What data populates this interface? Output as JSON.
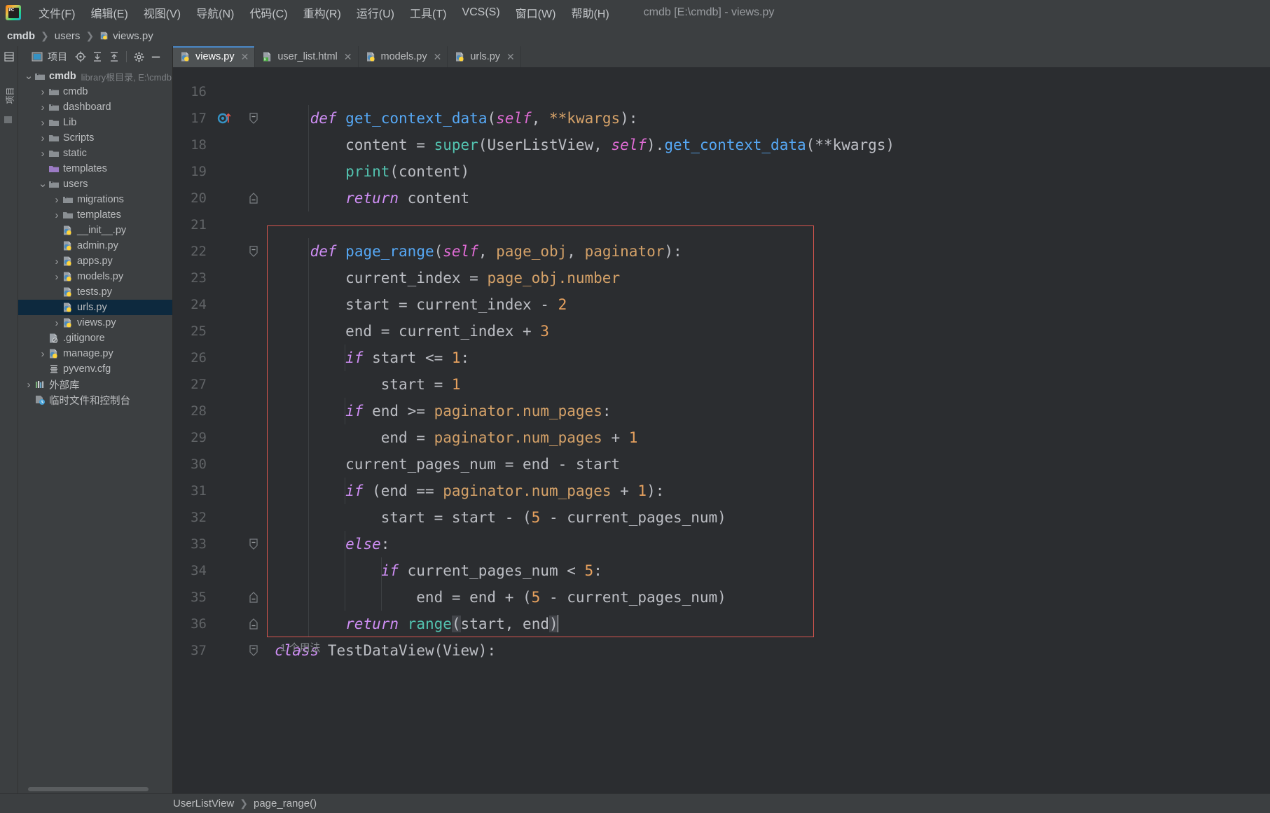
{
  "window": {
    "title": "cmdb [E:\\cmdb] - views.py"
  },
  "menu": {
    "items": [
      {
        "label": "文件(F)",
        "name": "menu-file"
      },
      {
        "label": "编辑(E)",
        "name": "menu-edit"
      },
      {
        "label": "视图(V)",
        "name": "menu-view"
      },
      {
        "label": "导航(N)",
        "name": "menu-navigate"
      },
      {
        "label": "代码(C)",
        "name": "menu-code"
      },
      {
        "label": "重构(R)",
        "name": "menu-refactor"
      },
      {
        "label": "运行(U)",
        "name": "menu-run"
      },
      {
        "label": "工具(T)",
        "name": "menu-tools"
      },
      {
        "label": "VCS(S)",
        "name": "menu-vcs"
      },
      {
        "label": "窗口(W)",
        "name": "menu-window"
      },
      {
        "label": "帮助(H)",
        "name": "menu-help"
      }
    ]
  },
  "breadcrumb": {
    "items": [
      "cmdb",
      "users",
      "views.py"
    ]
  },
  "toolstrip": {
    "vertical_label": "项目"
  },
  "project_panel": {
    "toolbar_label": "项目",
    "tree": [
      {
        "label": "cmdb",
        "sub": "library根目录, E:\\cmdb",
        "depth": 0,
        "chev": "v",
        "icon": "folder-module",
        "bold": true,
        "selected": false
      },
      {
        "label": "cmdb",
        "sub": "",
        "depth": 1,
        "chev": ">",
        "icon": "folder-module",
        "bold": false,
        "selected": false
      },
      {
        "label": "dashboard",
        "sub": "",
        "depth": 1,
        "chev": ">",
        "icon": "folder-module",
        "bold": false,
        "selected": false
      },
      {
        "label": "Lib",
        "sub": "",
        "depth": 1,
        "chev": ">",
        "icon": "folder",
        "bold": false,
        "selected": false
      },
      {
        "label": "Scripts",
        "sub": "",
        "depth": 1,
        "chev": ">",
        "icon": "folder",
        "bold": false,
        "selected": false
      },
      {
        "label": "static",
        "sub": "",
        "depth": 1,
        "chev": ">",
        "icon": "folder",
        "bold": false,
        "selected": false
      },
      {
        "label": "templates",
        "sub": "",
        "depth": 1,
        "chev": "",
        "icon": "folder-templates",
        "bold": false,
        "selected": false
      },
      {
        "label": "users",
        "sub": "",
        "depth": 1,
        "chev": "v",
        "icon": "folder-module",
        "bold": false,
        "selected": false
      },
      {
        "label": "migrations",
        "sub": "",
        "depth": 2,
        "chev": ">",
        "icon": "folder-module",
        "bold": false,
        "selected": false
      },
      {
        "label": "templates",
        "sub": "",
        "depth": 2,
        "chev": ">",
        "icon": "folder",
        "bold": false,
        "selected": false
      },
      {
        "label": "__init__.py",
        "sub": "",
        "depth": 2,
        "chev": "",
        "icon": "python",
        "bold": false,
        "selected": false
      },
      {
        "label": "admin.py",
        "sub": "",
        "depth": 2,
        "chev": "",
        "icon": "python",
        "bold": false,
        "selected": false
      },
      {
        "label": "apps.py",
        "sub": "",
        "depth": 2,
        "chev": ">",
        "icon": "python",
        "bold": false,
        "selected": false
      },
      {
        "label": "models.py",
        "sub": "",
        "depth": 2,
        "chev": ">",
        "icon": "python",
        "bold": false,
        "selected": false
      },
      {
        "label": "tests.py",
        "sub": "",
        "depth": 2,
        "chev": "",
        "icon": "python",
        "bold": false,
        "selected": false
      },
      {
        "label": "urls.py",
        "sub": "",
        "depth": 2,
        "chev": "",
        "icon": "python",
        "bold": false,
        "selected": true
      },
      {
        "label": "views.py",
        "sub": "",
        "depth": 2,
        "chev": ">",
        "icon": "python",
        "bold": false,
        "selected": false
      },
      {
        "label": ".gitignore",
        "sub": "",
        "depth": 1,
        "chev": "",
        "icon": "gitignore",
        "bold": false,
        "selected": false
      },
      {
        "label": "manage.py",
        "sub": "",
        "depth": 1,
        "chev": ">",
        "icon": "python",
        "bold": false,
        "selected": false
      },
      {
        "label": "pyvenv.cfg",
        "sub": "",
        "depth": 1,
        "chev": "",
        "icon": "cfg",
        "bold": false,
        "selected": false
      },
      {
        "label": "外部库",
        "sub": "",
        "depth": 0,
        "chev": ">",
        "icon": "library",
        "bold": false,
        "selected": false
      },
      {
        "label": "临时文件和控制台",
        "sub": "",
        "depth": 0,
        "chev": "",
        "icon": "scratch",
        "bold": false,
        "selected": false
      }
    ]
  },
  "editor_tabs": [
    {
      "label": "views.py",
      "icon": "python-file-icon",
      "active": true
    },
    {
      "label": "user_list.html",
      "icon": "html-file-icon",
      "active": false
    },
    {
      "label": "models.py",
      "icon": "python-file-icon",
      "active": false
    },
    {
      "label": "urls.py",
      "icon": "python-file-icon",
      "active": false
    }
  ],
  "editor": {
    "first_visible_line": 16,
    "usage_hint": "1 个用法",
    "lines": [
      {
        "n": 16,
        "text": "",
        "tokens": []
      },
      {
        "n": 17,
        "text": "    def get_context_data(self, **kwargs):",
        "tokens": [
          {
            "t": "    ",
            "c": "txt"
          },
          {
            "t": "def",
            "c": "kw"
          },
          {
            "t": " ",
            "c": "txt"
          },
          {
            "t": "get_context_data",
            "c": "fn"
          },
          {
            "t": "(",
            "c": "pn"
          },
          {
            "t": "self",
            "c": "slf"
          },
          {
            "t": ", ",
            "c": "pn"
          },
          {
            "t": "**kwargs",
            "c": "par"
          },
          {
            "t": "):",
            "c": "pn"
          }
        ],
        "breakpoint": true,
        "fold": "end"
      },
      {
        "n": 18,
        "text": "        content = super(UserListView, self).get_context_data(**kwargs)",
        "tokens": [
          {
            "t": "        content = ",
            "c": "txt"
          },
          {
            "t": "super",
            "c": "bi"
          },
          {
            "t": "(UserListView, ",
            "c": "txt"
          },
          {
            "t": "self",
            "c": "slf"
          },
          {
            "t": ").",
            "c": "txt"
          },
          {
            "t": "get_context_data",
            "c": "fn"
          },
          {
            "t": "(**kwargs)",
            "c": "txt"
          }
        ]
      },
      {
        "n": 19,
        "text": "        print(content)",
        "tokens": [
          {
            "t": "        ",
            "c": "txt"
          },
          {
            "t": "print",
            "c": "bi"
          },
          {
            "t": "(content)",
            "c": "txt"
          }
        ]
      },
      {
        "n": 20,
        "text": "        return content",
        "tokens": [
          {
            "t": "        ",
            "c": "txt"
          },
          {
            "t": "return",
            "c": "kw"
          },
          {
            "t": " content",
            "c": "txt"
          }
        ],
        "fold": "tail"
      },
      {
        "n": 21,
        "text": "",
        "tokens": []
      },
      {
        "n": 22,
        "text": "    def page_range(self, page_obj, paginator):",
        "tokens": [
          {
            "t": "    ",
            "c": "txt"
          },
          {
            "t": "def",
            "c": "kw"
          },
          {
            "t": " ",
            "c": "txt"
          },
          {
            "t": "page_range",
            "c": "fn"
          },
          {
            "t": "(",
            "c": "pn"
          },
          {
            "t": "self",
            "c": "slf"
          },
          {
            "t": ", ",
            "c": "pn"
          },
          {
            "t": "page_obj",
            "c": "par"
          },
          {
            "t": ", ",
            "c": "pn"
          },
          {
            "t": "paginator",
            "c": "par"
          },
          {
            "t": "):",
            "c": "pn"
          }
        ],
        "fold": "end"
      },
      {
        "n": 23,
        "text": "        current_index = page_obj.number",
        "tokens": [
          {
            "t": "        current_index = ",
            "c": "txt"
          },
          {
            "t": "page_obj",
            "c": "par"
          },
          {
            "t": ".number",
            "c": "par"
          }
        ]
      },
      {
        "n": 24,
        "text": "        start = current_index - 2",
        "tokens": [
          {
            "t": "        start = current_index - ",
            "c": "txt"
          },
          {
            "t": "2",
            "c": "num"
          }
        ]
      },
      {
        "n": 25,
        "text": "        end = current_index + 3",
        "tokens": [
          {
            "t": "        end = current_index + ",
            "c": "txt"
          },
          {
            "t": "3",
            "c": "num"
          }
        ]
      },
      {
        "n": 26,
        "text": "        if start <= 1:",
        "tokens": [
          {
            "t": "        ",
            "c": "txt"
          },
          {
            "t": "if",
            "c": "kw"
          },
          {
            "t": " start <= ",
            "c": "txt"
          },
          {
            "t": "1",
            "c": "num"
          },
          {
            "t": ":",
            "c": "txt"
          }
        ]
      },
      {
        "n": 27,
        "text": "            start = 1",
        "tokens": [
          {
            "t": "            start = ",
            "c": "txt"
          },
          {
            "t": "1",
            "c": "num"
          }
        ]
      },
      {
        "n": 28,
        "text": "        if end >= paginator.num_pages:",
        "tokens": [
          {
            "t": "        ",
            "c": "txt"
          },
          {
            "t": "if",
            "c": "kw"
          },
          {
            "t": " end >= ",
            "c": "txt"
          },
          {
            "t": "paginator",
            "c": "par"
          },
          {
            "t": ".num_pages",
            "c": "par"
          },
          {
            "t": ":",
            "c": "txt"
          }
        ]
      },
      {
        "n": 29,
        "text": "            end = paginator.num_pages + 1",
        "tokens": [
          {
            "t": "            end = ",
            "c": "txt"
          },
          {
            "t": "paginator",
            "c": "par"
          },
          {
            "t": ".num_pages",
            "c": "par"
          },
          {
            "t": " + ",
            "c": "txt"
          },
          {
            "t": "1",
            "c": "num"
          }
        ]
      },
      {
        "n": 30,
        "text": "        current_pages_num = end - start",
        "tokens": [
          {
            "t": "        current_pages_num = end - start",
            "c": "txt"
          }
        ]
      },
      {
        "n": 31,
        "text": "        if (end == paginator.num_pages + 1):",
        "tokens": [
          {
            "t": "        ",
            "c": "txt"
          },
          {
            "t": "if",
            "c": "kw"
          },
          {
            "t": " (end == ",
            "c": "txt"
          },
          {
            "t": "paginator",
            "c": "par"
          },
          {
            "t": ".num_pages",
            "c": "par"
          },
          {
            "t": " + ",
            "c": "txt"
          },
          {
            "t": "1",
            "c": "num"
          },
          {
            "t": "):",
            "c": "txt"
          }
        ]
      },
      {
        "n": 32,
        "text": "            start = start - (5 - current_pages_num)",
        "tokens": [
          {
            "t": "            start = start - (",
            "c": "txt"
          },
          {
            "t": "5",
            "c": "num"
          },
          {
            "t": " - current_pages_num)",
            "c": "txt"
          }
        ]
      },
      {
        "n": 33,
        "text": "        else:",
        "tokens": [
          {
            "t": "        ",
            "c": "txt"
          },
          {
            "t": "else",
            "c": "kw"
          },
          {
            "t": ":",
            "c": "txt"
          }
        ],
        "fold": "end"
      },
      {
        "n": 34,
        "text": "            if current_pages_num < 5:",
        "tokens": [
          {
            "t": "            ",
            "c": "txt"
          },
          {
            "t": "if",
            "c": "kw"
          },
          {
            "t": " current_pages_num < ",
            "c": "txt"
          },
          {
            "t": "5",
            "c": "num"
          },
          {
            "t": ":",
            "c": "txt"
          }
        ]
      },
      {
        "n": 35,
        "text": "                end = end + (5 - current_pages_num)",
        "tokens": [
          {
            "t": "                end = end + (",
            "c": "txt"
          },
          {
            "t": "5",
            "c": "num"
          },
          {
            "t": " - current_pages_num)",
            "c": "txt"
          }
        ],
        "fold": "tail"
      },
      {
        "n": 36,
        "text": "        return range(start, end)",
        "tokens": [
          {
            "t": "        ",
            "c": "txt"
          },
          {
            "t": "return",
            "c": "kw"
          },
          {
            "t": " ",
            "c": "txt"
          },
          {
            "t": "range",
            "c": "bi"
          },
          {
            "t": "(start, end)",
            "c": "txt"
          }
        ],
        "fold": "tail",
        "caret": true
      },
      {
        "n": 37,
        "text": "class TestDataView(View):",
        "tokens": [
          {
            "t": "class",
            "c": "kw"
          },
          {
            "t": " ",
            "c": "txt"
          },
          {
            "t": "TestDataView",
            "c": "cls"
          },
          {
            "t": "(View):",
            "c": "txt"
          }
        ],
        "fold": "end"
      }
    ]
  },
  "status_bar": {
    "crumbs": [
      "UserListView",
      "page_range()"
    ]
  },
  "colors": {
    "accent_tab_underline": "#4a88c7",
    "selection_blue": "#0d293e",
    "red_box": "#d9564f",
    "editor_bg": "#2b2d30",
    "panel_bg": "#3c3f41"
  }
}
